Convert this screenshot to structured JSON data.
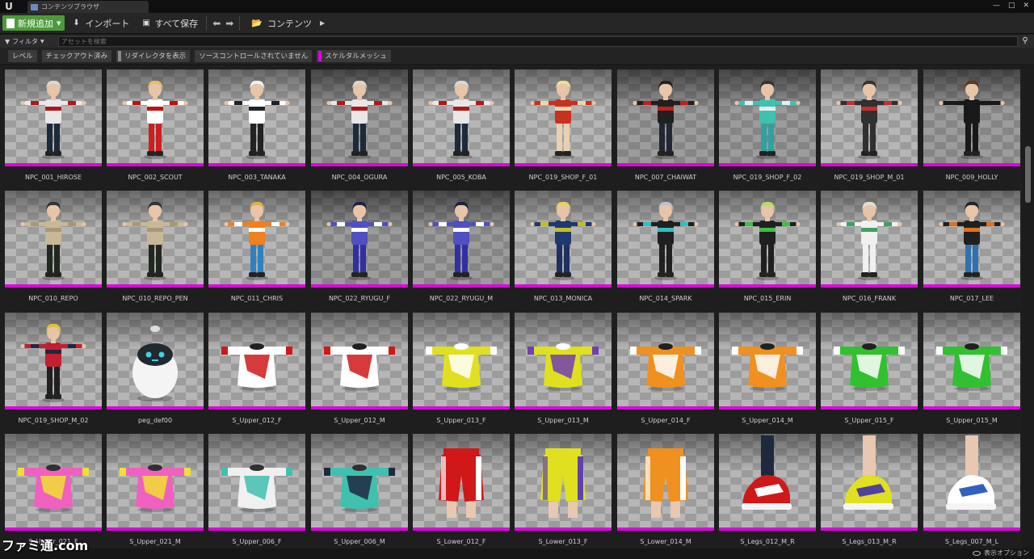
{
  "titlebar": {
    "tab_label": "コンテンツブラウザ",
    "minimize": "—",
    "maximize": "□",
    "close": "✕"
  },
  "toolbar": {
    "add_new_label": "新規追加",
    "import_label": "インポート",
    "save_all_label": "すべて保存",
    "path_label": "コンテンツ"
  },
  "filter": {
    "filter_label": "フィルタ",
    "search_placeholder": "アセットを検索"
  },
  "chips": [
    {
      "label": "レベル",
      "swatch": false,
      "active": false
    },
    {
      "label": "チェックアウト済み",
      "swatch": false,
      "active": false
    },
    {
      "label": "リダイレクタを表示",
      "swatch": true,
      "active": false
    },
    {
      "label": "ソースコントロールされていません",
      "swatch": false,
      "active": false
    },
    {
      "label": "スケルタルメッシュ",
      "swatch": true,
      "active": true
    }
  ],
  "accent_color": "#e000e0",
  "assets": [
    [
      {
        "name": "NPC_001_HIROSE",
        "kind": "person",
        "top": "#e8e8e8",
        "accent": "#b01818",
        "legs": "#1c2a3a",
        "hair": "#d8d8d8",
        "bg": "light"
      },
      {
        "name": "NPC_002_SCOUT",
        "kind": "person",
        "top": "#ffffff",
        "accent": "#c01010",
        "legs": "#cc2020",
        "hair": "#e8c060",
        "bg": "light"
      },
      {
        "name": "NPC_003_TANAKA",
        "kind": "person",
        "top": "#ffffff",
        "accent": "#222222",
        "legs": "#222222",
        "hair": "#f0f0f0",
        "bg": "light"
      },
      {
        "name": "NPC_004_OGURA",
        "kind": "person",
        "top": "#e8e8e8",
        "accent": "#b01818",
        "legs": "#1c2a3a",
        "hair": "#d8d8d8",
        "bg": "dark"
      },
      {
        "name": "NPC_005_KOBA",
        "kind": "person",
        "top": "#e8e8e8",
        "accent": "#b01818",
        "legs": "#1c2a3a",
        "hair": "#d8d8d8",
        "bg": "light"
      },
      {
        "name": "NPC_019_SHOP_F_01",
        "kind": "person",
        "top": "#c83020",
        "accent": "#e8d8b0",
        "legs": "#e8d0b0",
        "hair": "#f0e090",
        "bg": "light"
      },
      {
        "name": "NPC_007_CHAIWAT",
        "kind": "person",
        "top": "#202020",
        "accent": "#c02020",
        "legs": "#222833",
        "hair": "#222222",
        "bg": "dark"
      },
      {
        "name": "NPC_019_SHOP_F_02",
        "kind": "person",
        "top": "#40c0b0",
        "accent": "#e0f0f0",
        "legs": "#30a0a0",
        "hair": "#333333",
        "bg": "dark"
      },
      {
        "name": "NPC_019_SHOP_M_01",
        "kind": "person",
        "top": "#303030",
        "accent": "#c03030",
        "legs": "#303030",
        "hair": "#333333",
        "bg": "light"
      },
      {
        "name": "NPC_009_HOLLY",
        "kind": "person",
        "top": "#181818",
        "accent": "#181818",
        "legs": "#181818",
        "hair": "#603820",
        "bg": "dark"
      }
    ],
    [
      {
        "name": "NPC_010_REPO",
        "kind": "person",
        "top": "#c8b898",
        "accent": "#a89878",
        "legs": "#202820",
        "hair": "#333333",
        "bg": "light"
      },
      {
        "name": "NPC_010_REPO_PEN",
        "kind": "person",
        "top": "#c8b898",
        "accent": "#a89878",
        "legs": "#202820",
        "hair": "#333333",
        "bg": "light"
      },
      {
        "name": "NPC_011_CHRIS",
        "kind": "person",
        "top": "#f08020",
        "accent": "#ffffff",
        "legs": "#3080c0",
        "hair": "#e0b040",
        "bg": "light"
      },
      {
        "name": "NPC_022_RYUGU_F",
        "kind": "person",
        "top": "#5050c0",
        "accent": "#ffffff",
        "legs": "#3030a0",
        "hair": "#202040",
        "bg": "dark"
      },
      {
        "name": "NPC_022_RYUGU_M",
        "kind": "person",
        "top": "#5050c0",
        "accent": "#ffffff",
        "legs": "#3030a0",
        "hair": "#202040",
        "bg": "dark"
      },
      {
        "name": "NPC_013_MONICA",
        "kind": "person",
        "top": "#203870",
        "accent": "#c0c020",
        "legs": "#203060",
        "hair": "#e8d060",
        "bg": "light"
      },
      {
        "name": "NPC_014_SPARK",
        "kind": "person",
        "top": "#202020",
        "accent": "#30c0c0",
        "legs": "#202020",
        "hair": "#c0c0d0",
        "bg": "light"
      },
      {
        "name": "NPC_015_ERIN",
        "kind": "person",
        "top": "#202020",
        "accent": "#40c040",
        "legs": "#202020",
        "hair": "#b0e060",
        "bg": "light"
      },
      {
        "name": "NPC_016_FRANK",
        "kind": "person",
        "top": "#f0f0f0",
        "accent": "#40a060",
        "legs": "#f0f0f0",
        "hair": "#e0e0d0",
        "bg": "light"
      },
      {
        "name": "NPC_017_LEE",
        "kind": "person",
        "top": "#202020",
        "accent": "#e07020",
        "legs": "#3070b0",
        "hair": "#222222",
        "bg": "light"
      }
    ],
    [
      {
        "name": "NPC_019_SHOP_M_02",
        "kind": "person",
        "top": "#c02030",
        "accent": "#202840",
        "legs": "#202020",
        "hair": "#e0c040",
        "bg": "light"
      },
      {
        "name": "peg_def00",
        "kind": "robot",
        "top": "#f4f4f4",
        "accent": "#202830",
        "legs": "#f4f4f4",
        "hair": "#40d0e0",
        "bg": "light"
      },
      {
        "name": "S_Upper_012_F",
        "kind": "shirt",
        "top": "#ffffff",
        "accent": "#d01818",
        "legs": "#ffffff",
        "hair": "#202020",
        "bg": "light"
      },
      {
        "name": "S_Upper_012_M",
        "kind": "shirt",
        "top": "#ffffff",
        "accent": "#d01818",
        "legs": "#ffffff",
        "hair": "#202020",
        "bg": "light"
      },
      {
        "name": "S_Upper_013_F",
        "kind": "shirt",
        "top": "#e0e020",
        "accent": "#ffffff",
        "legs": "#e0e020",
        "hair": "#ffffff",
        "bg": "light"
      },
      {
        "name": "S_Upper_013_M",
        "kind": "shirt",
        "top": "#e0e020",
        "accent": "#7040b0",
        "legs": "#e0e020",
        "hair": "#ffffff",
        "bg": "light"
      },
      {
        "name": "S_Upper_014_F",
        "kind": "shirt",
        "top": "#f09020",
        "accent": "#ffffff",
        "legs": "#f09020",
        "hair": "#202020",
        "bg": "light"
      },
      {
        "name": "S_Upper_014_M",
        "kind": "shirt",
        "top": "#f09020",
        "accent": "#ffffff",
        "legs": "#f09020",
        "hair": "#202020",
        "bg": "light"
      },
      {
        "name": "S_Upper_015_F",
        "kind": "shirt",
        "top": "#30c030",
        "accent": "#ffffff",
        "legs": "#30c030",
        "hair": "#202020",
        "bg": "light"
      },
      {
        "name": "S_Upper_015_M",
        "kind": "shirt",
        "top": "#30c030",
        "accent": "#ffffff",
        "legs": "#30c030",
        "hair": "#202020",
        "bg": "light"
      }
    ],
    [
      {
        "name": "S_Upper_021_F",
        "kind": "shirt",
        "top": "#f060c0",
        "accent": "#f0e030",
        "legs": "#f060c0",
        "hair": "#303030",
        "bg": "light"
      },
      {
        "name": "S_Upper_021_M",
        "kind": "shirt",
        "top": "#f060c0",
        "accent": "#f0e030",
        "legs": "#f060c0",
        "hair": "#303030",
        "bg": "light"
      },
      {
        "name": "S_Upper_006_F",
        "kind": "shirt",
        "top": "#f0f0f0",
        "accent": "#40c0b0",
        "legs": "#f0f0f0",
        "hair": "#303030",
        "bg": "light"
      },
      {
        "name": "S_Upper_006_M",
        "kind": "shirt",
        "top": "#40c0b0",
        "accent": "#202840",
        "legs": "#40c0b0",
        "hair": "#303030",
        "bg": "light"
      },
      {
        "name": "S_Lower_012_F",
        "kind": "shorts",
        "top": "#d01818",
        "accent": "#ffffff",
        "legs": "#e8c8b0",
        "hair": "#303030",
        "bg": "light"
      },
      {
        "name": "S_Lower_013_F",
        "kind": "shorts",
        "top": "#e0e020",
        "accent": "#6040b0",
        "legs": "#e8c8b0",
        "hair": "#303030",
        "bg": "light"
      },
      {
        "name": "S_Lower_014_M",
        "kind": "shorts",
        "top": "#f09020",
        "accent": "#ffffff",
        "legs": "#e8c8b0",
        "hair": "#303030",
        "bg": "light"
      },
      {
        "name": "S_Legs_012_M_R",
        "kind": "shoe",
        "top": "#d01818",
        "accent": "#ffffff",
        "legs": "#202840",
        "hair": "#303030",
        "bg": "light"
      },
      {
        "name": "S_Legs_013_M_R",
        "kind": "shoe",
        "top": "#e0e020",
        "accent": "#5040a0",
        "legs": "#e8c8b0",
        "hair": "#303030",
        "bg": "light"
      },
      {
        "name": "S_Legs_007_M_L",
        "kind": "shoe",
        "top": "#ffffff",
        "accent": "#3060c0",
        "legs": "#e8c8b0",
        "hair": "#303030",
        "bg": "light"
      }
    ]
  ],
  "status": {
    "view_options_label": "表示オプション"
  },
  "watermark": "ファミ通.com"
}
